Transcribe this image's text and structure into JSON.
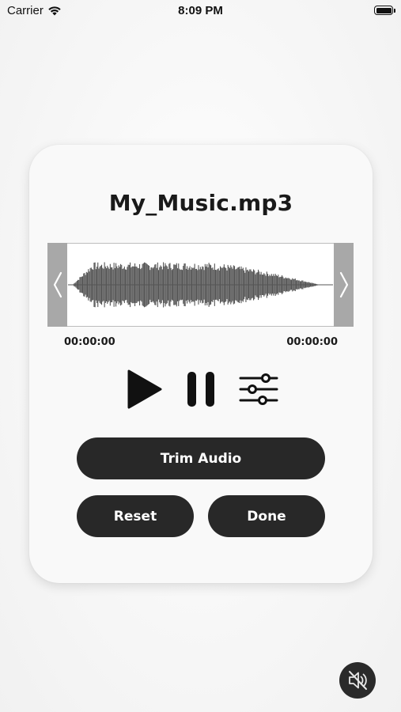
{
  "status_bar": {
    "carrier": "Carrier",
    "time": "8:09 PM",
    "battery_level": 1.0
  },
  "player": {
    "file_name": "My_Music.mp3",
    "start_time": "00:00:00",
    "end_time": "00:00:00",
    "icons": {
      "left_handle": "chevron-left-icon",
      "right_handle": "chevron-right-icon",
      "play": "play-icon",
      "pause": "pause-icon",
      "settings": "sliders-icon"
    }
  },
  "buttons": {
    "trim_label": "Trim Audio",
    "reset_label": "Reset",
    "done_label": "Done"
  },
  "mute": {
    "icon": "speaker-muted-icon"
  },
  "colors": {
    "button_bg": "#282828",
    "handle": "#a8a8a8",
    "waveform": "#555555"
  }
}
